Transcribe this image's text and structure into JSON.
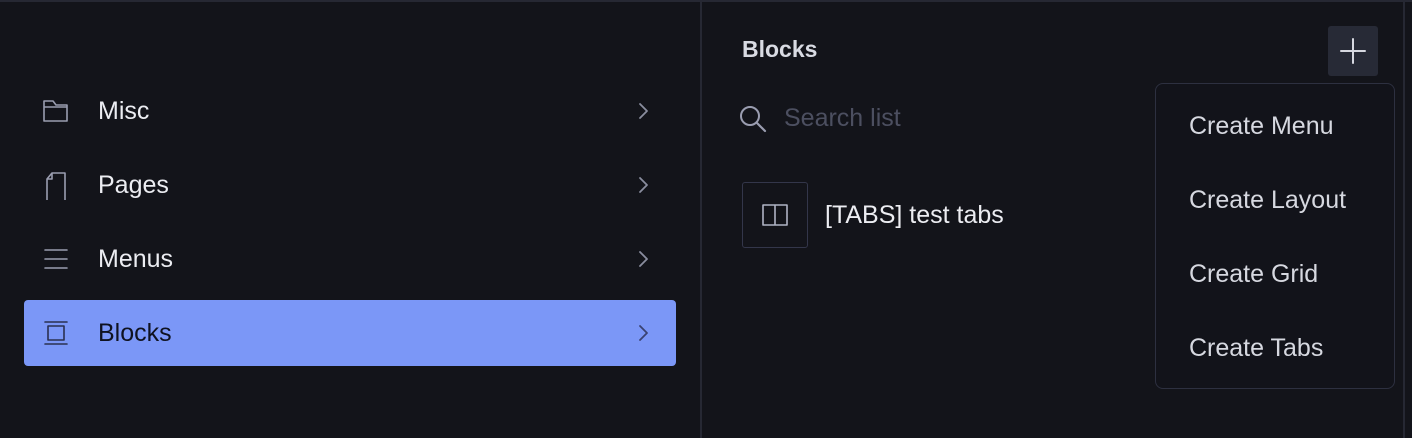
{
  "sidebar": {
    "items": [
      {
        "label": "Misc",
        "icon": "folder-icon",
        "active": false
      },
      {
        "label": "Pages",
        "icon": "page-icon",
        "active": false
      },
      {
        "label": "Menus",
        "icon": "menu-lines-icon",
        "active": false
      },
      {
        "label": "Blocks",
        "icon": "block-icon",
        "active": true
      }
    ]
  },
  "panel": {
    "title": "Blocks",
    "add_icon": "plus-icon",
    "search": {
      "placeholder": "Search list",
      "value": ""
    },
    "list": [
      {
        "label": "[TABS] test tabs",
        "icon": "tabs-icon"
      }
    ]
  },
  "menu": {
    "items": [
      {
        "label": "Create Menu"
      },
      {
        "label": "Create Layout"
      },
      {
        "label": "Create Grid"
      },
      {
        "label": "Create Tabs"
      }
    ]
  },
  "colors": {
    "background": "#13141a",
    "accent": "#7b97f7",
    "divider": "#262833",
    "button_bg": "#272a36"
  }
}
